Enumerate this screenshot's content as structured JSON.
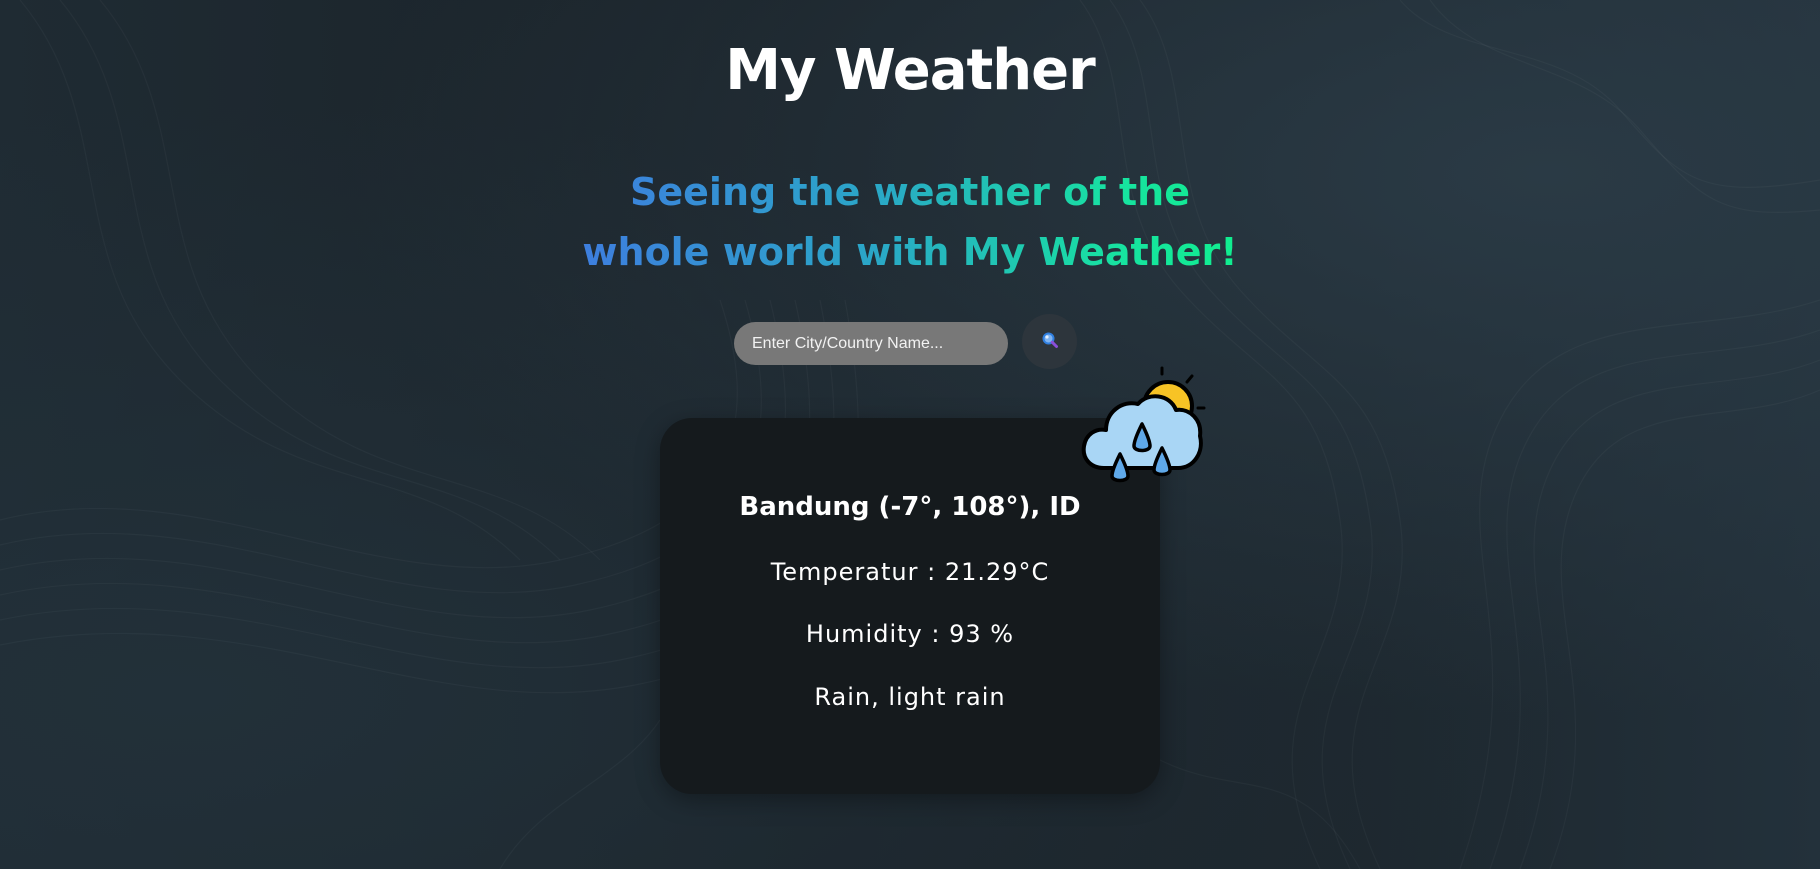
{
  "header": {
    "title": "My Weather",
    "tagline": "Seeing the weather of the whole world with My Weather!"
  },
  "search": {
    "placeholder": "Enter City/Country Name...",
    "value": "",
    "button_icon": "search-icon"
  },
  "weather": {
    "location": "Bandung (-7°, 108°), ID",
    "temperature": "Temperatur : 21.29°C",
    "humidity": "Humidity : 93 %",
    "description": "Rain, light rain",
    "icon": "cloud-sun-rain-icon"
  },
  "colors": {
    "gradient_start": "#3f7be0",
    "gradient_end": "#0ff08c",
    "card_background": "#151a1d",
    "input_background": "#787878",
    "sun": "#f7c325",
    "cloud": "#a9d6f5",
    "rain": "#5fa8e8"
  }
}
